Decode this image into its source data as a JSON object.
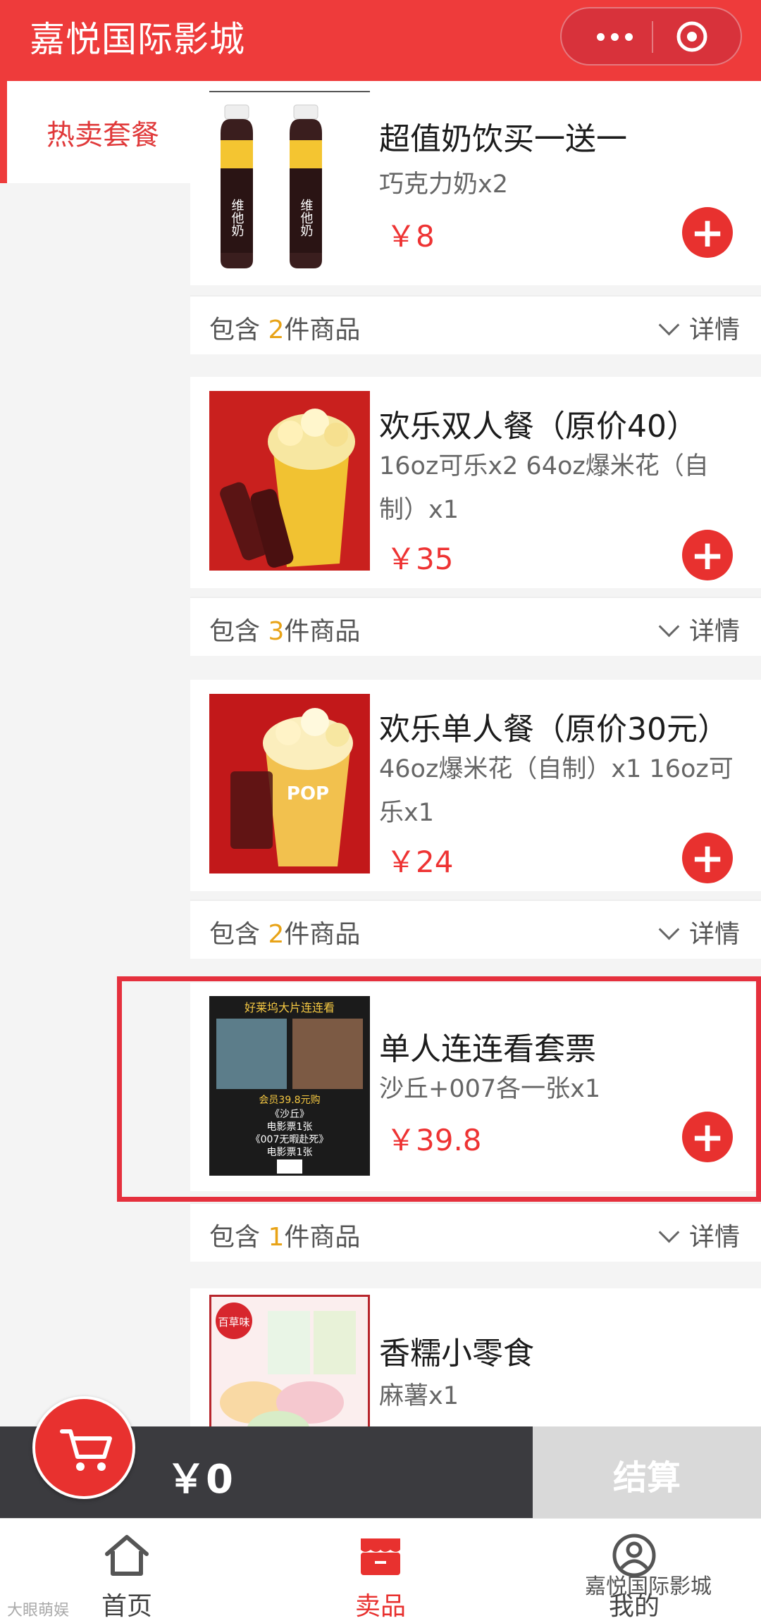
{
  "header": {
    "title": "嘉悦国际影城"
  },
  "sidebar": {
    "items": [
      {
        "label": "热卖套餐"
      }
    ]
  },
  "products": [
    {
      "name": "超值奶饮买一送一",
      "desc": "巧克力奶x2",
      "price": "￥8",
      "count_prefix": "包含",
      "count": "2",
      "count_suffix": "件商品",
      "detail": "详情"
    },
    {
      "name": "欢乐双人餐（原价40）",
      "desc": "16oz可乐x2 64oz爆米花（自制）x1",
      "price": "￥35",
      "count_prefix": "包含",
      "count": "3",
      "count_suffix": "件商品",
      "detail": "详情"
    },
    {
      "name": "欢乐单人餐（原价30元）",
      "desc": "46oz爆米花（自制）x1 16oz可乐x1",
      "price": "￥24",
      "count_prefix": "包含",
      "count": "2",
      "count_suffix": "件商品",
      "detail": "详情"
    },
    {
      "name": "单人连连看套票",
      "desc": "沙丘+007各一张x1",
      "price": "￥39.8",
      "count_prefix": "包含",
      "count": "1",
      "count_suffix": "件商品",
      "detail": "详情"
    },
    {
      "name": "香糯小零食",
      "desc": "麻薯x1",
      "price": "",
      "count_prefix": "",
      "count": "",
      "count_suffix": "",
      "detail": ""
    }
  ],
  "thumbs": {
    "poster_title": "好莱坞大片连连看",
    "poster_line1": "会员39.8元购",
    "poster_line2": "《沙丘》",
    "poster_line3": "电影票1张",
    "poster_line4": "《007无暇赴死》",
    "poster_line5": "电影票1张",
    "snack_brand": "百草味",
    "drink_brand": "维他奶"
  },
  "cart": {
    "total": "￥0",
    "checkout": "结算"
  },
  "tabs": [
    {
      "label": "首页",
      "icon": "home-icon"
    },
    {
      "label": "卖品",
      "icon": "store-icon"
    },
    {
      "label": "我的",
      "icon": "user-icon"
    }
  ],
  "watermarks": {
    "right": "嘉悦国际影城",
    "left": "大眼萌娱"
  },
  "colors": {
    "brand": "#ee3b3b",
    "price": "#e33333",
    "count": "#e8a317"
  }
}
